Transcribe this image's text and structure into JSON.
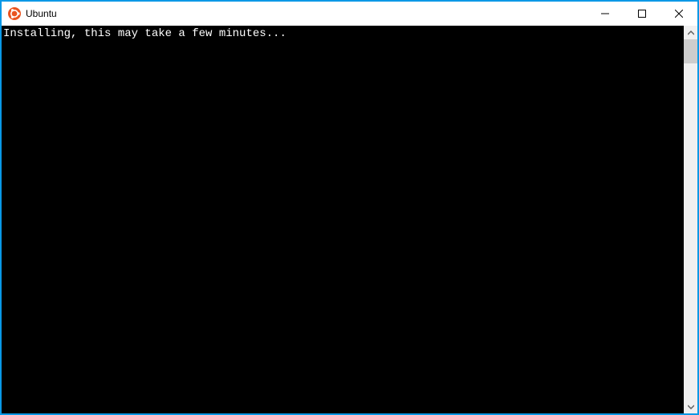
{
  "window": {
    "title": "Ubuntu"
  },
  "terminal": {
    "line1": "Installing, this may take a few minutes..."
  }
}
